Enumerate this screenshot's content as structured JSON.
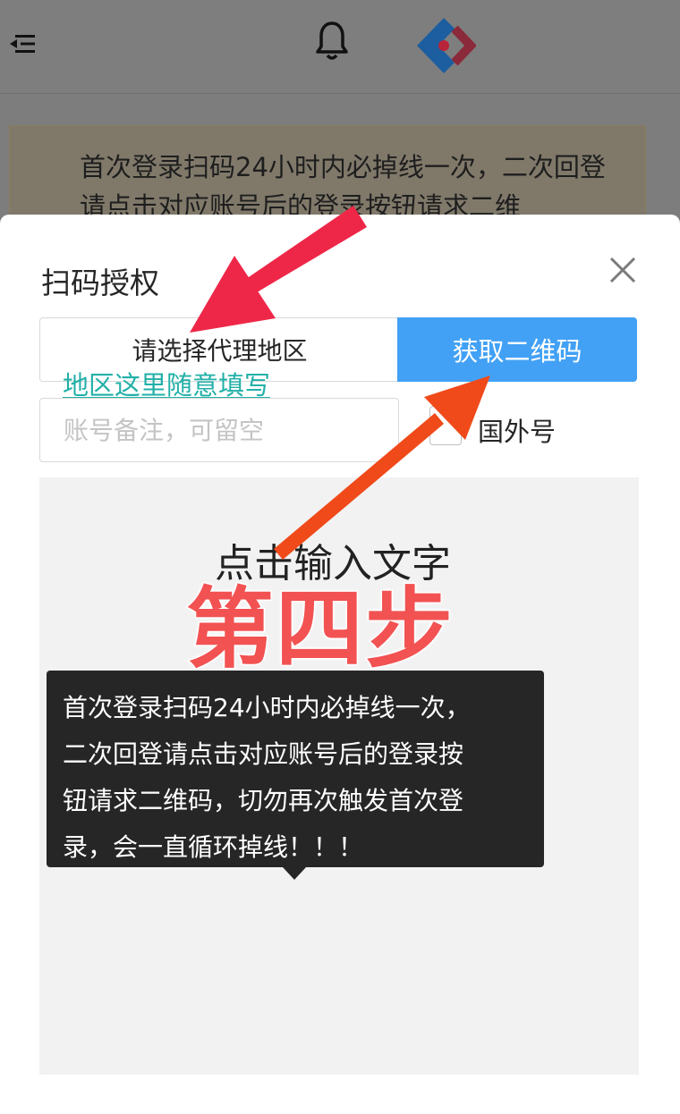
{
  "background": {
    "notice_text": "首次登录扫码24小时内必掉线一次，二次回登请点击对应账号后的登录按钮请求二维"
  },
  "icons": {
    "menu": "menu-fold-icon",
    "bell": "bell-icon",
    "logo": "diamond-logo-icon",
    "close": "close-icon"
  },
  "modal": {
    "title": "扫码授权",
    "region_select_label": "请选择代理地区",
    "get_qr_button": "获取二维码",
    "region_hint": "地区这里随意填写",
    "remark_placeholder": "账号备注，可留空",
    "remark_value": "",
    "foreign_checked": false,
    "foreign_label": "国外号",
    "overlay_caption": "点击输入文字",
    "step_label": "第四步",
    "tooltip_lines": [
      "首次登录扫码24小时内必掉线一次，",
      "二次回登请点击对应账号后的登录按",
      "钮请求二维码，切勿再次触发首次登",
      "录，会一直循环掉线！！！"
    ]
  },
  "colors": {
    "primary_button": "#42a1f5",
    "hint_text": "#22b0a8",
    "annotation_red": "#ee2748",
    "annotation_orange": "#f04a1a",
    "step_text": "#f25252"
  }
}
